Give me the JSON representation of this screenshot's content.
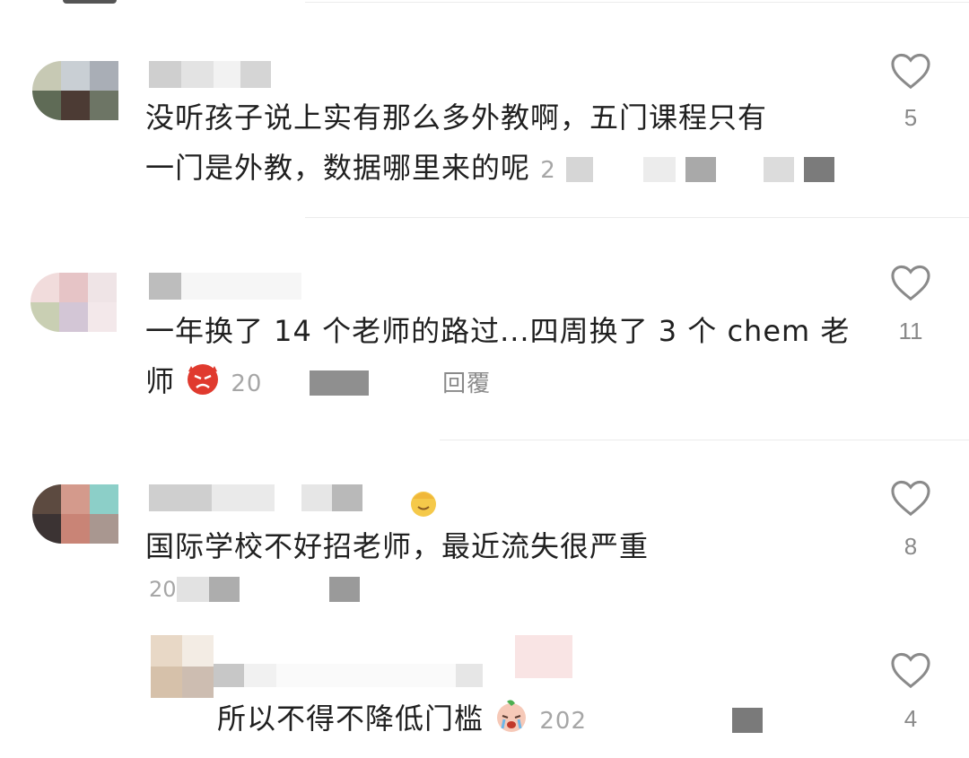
{
  "comments": [
    {
      "text_line1": "没听孩子说上实有那么多外教啊，五门课程只有",
      "text_line2": "一门是外教，数据哪里来的呢",
      "meta": "2",
      "likes": "5"
    },
    {
      "text_line1": "一年换了 14 个老师的路过...四周换了 3 个 chem 老",
      "text_line2": "师",
      "meta": "20",
      "reply": "回覆",
      "likes": "11"
    },
    {
      "text_line1": "国际学校不好招老师，最近流失很严重",
      "meta": "20",
      "likes": "8"
    },
    {
      "text_line1": "所以不得不降低门槛",
      "meta": "202",
      "likes": "4"
    }
  ],
  "icons": {
    "like": "heart-outline-icon",
    "angry_emoji": "angry-face-emoji-icon",
    "crying_emoji": "crying-face-emoji-icon",
    "smile_emoji": "smiling-face-emoji-icon"
  },
  "colors": {
    "text": "#202020",
    "meta": "#a6a6a6",
    "icon": "#8a8a8a"
  }
}
